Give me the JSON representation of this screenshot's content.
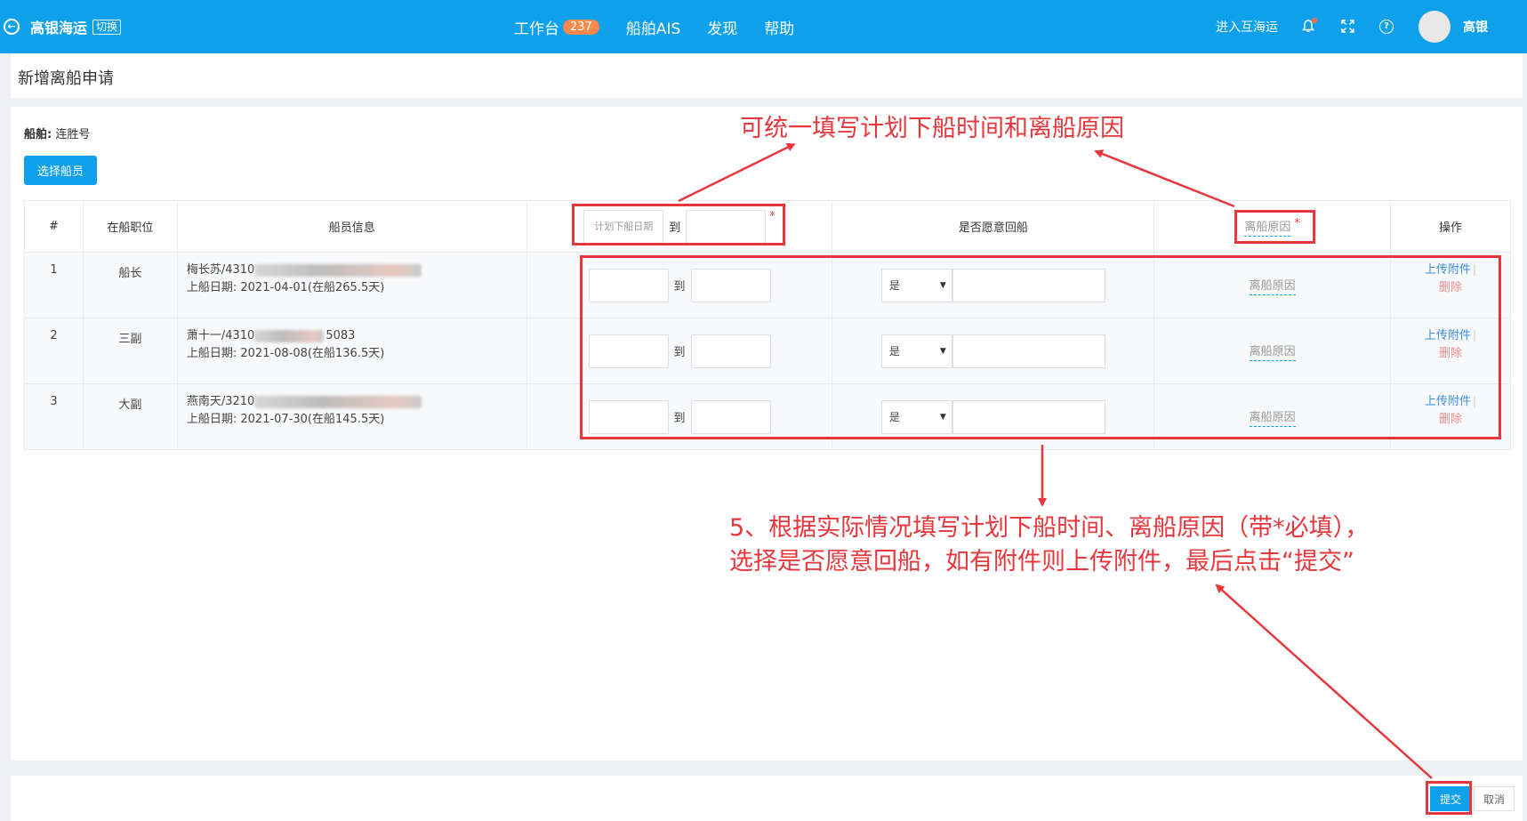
{
  "topbar": {
    "back_icon": "back-circle-icon",
    "brand": "高银海运",
    "switch_label": "切换",
    "nav": [
      {
        "label": "工作台",
        "badge": "237"
      },
      {
        "label": "船舶AIS"
      },
      {
        "label": "发现"
      },
      {
        "label": "帮助"
      }
    ],
    "enter_link": "进入互海运",
    "user": "高银"
  },
  "page_title": "新增离船申请",
  "ship": {
    "label": "船舶:",
    "value": "连胜号"
  },
  "select_crew_button": "选择船员",
  "table": {
    "headers": {
      "index": "#",
      "position": "在船职位",
      "crew_info": "船员信息",
      "plan_placeholder": "计划下船日期",
      "to": "到",
      "willing": "是否愿意回船",
      "reason": "离船原因",
      "ops": "操作"
    },
    "rows": [
      {
        "index": "1",
        "position": "船长",
        "name_id": "梅长苏/4310",
        "id_tail": "",
        "board_label": "上船日期:",
        "board_date": "2021-04-01(在船265.5天)",
        "willing": "是",
        "reason": "离船原因",
        "upload": "上传附件",
        "delete": "删除"
      },
      {
        "index": "2",
        "position": "三副",
        "name_id": "萧十一/4310",
        "id_tail": "5083",
        "board_label": "上船日期:",
        "board_date": "2021-08-08(在船136.5天)",
        "willing": "是",
        "reason": "离船原因",
        "upload": "上传附件",
        "delete": "删除"
      },
      {
        "index": "3",
        "position": "大副",
        "name_id": "燕南天/3210",
        "id_tail": "",
        "board_label": "上船日期:",
        "board_date": "2021-07-30(在船145.5天)",
        "willing": "是",
        "reason": "离船原因",
        "upload": "上传附件",
        "delete": "删除"
      }
    ]
  },
  "footer": {
    "submit": "提交",
    "cancel": "取消"
  },
  "annotations": {
    "top": "可统一填写计划下船时间和离船原因",
    "bottom_line1": "5、根据实际情况填写计划下船时间、离船原因（带*必填），",
    "bottom_line2": "选择是否愿意回船，如有附件则上传附件，最后点击“提交”",
    "color": "#e8373c"
  },
  "colors": {
    "primary": "#0ea0ea",
    "badge": "#f78a4a",
    "danger_text": "#f08a8a",
    "link": "#3a8ee6"
  }
}
